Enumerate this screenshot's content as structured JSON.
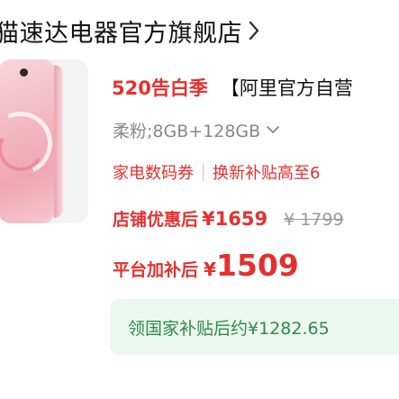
{
  "store": {
    "name": "猫速达电器官方旗舰店"
  },
  "product": {
    "promo_tag": "520告白季",
    "title": "【阿里官方自营",
    "variant": "柔粉;8GB+128GB",
    "coupons": [
      "家电数码券",
      "换新补贴高至6"
    ],
    "store_price_label": "店铺优惠后",
    "store_price": "¥1659",
    "original_price": "¥ 1799",
    "final_price_label": "平台加补后",
    "final_currency": "¥",
    "final_price": "1509",
    "subsidy_text": "领国家补贴后约¥1282.65"
  },
  "colors": {
    "accent_red": "#e5302e",
    "subsidy_green": "#2e8b4e",
    "subsidy_bg": "#ecf7ef"
  },
  "icons": {
    "store_chevron": "chevron-right-icon",
    "variant_chevron": "chevron-down-icon"
  }
}
